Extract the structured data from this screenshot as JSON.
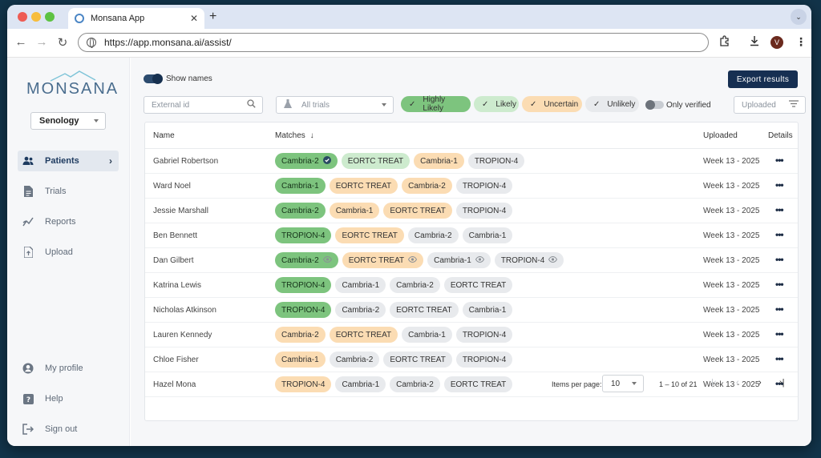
{
  "browser": {
    "tab_title": "Monsana App",
    "tab_close": "✕",
    "new_tab": "+",
    "tab_menu": "⌄",
    "url": "https://app.monsana.ai/assist/",
    "profile_initial": "V"
  },
  "sidebar": {
    "logo": "MONSANA",
    "dataset_selected": "Senology",
    "nav": [
      {
        "label": "Patients",
        "icon": "people-icon",
        "active": true
      },
      {
        "label": "Trials",
        "icon": "document-icon"
      },
      {
        "label": "Reports",
        "icon": "chart-icon"
      },
      {
        "label": "Upload",
        "icon": "upload-icon"
      }
    ],
    "bottom_nav": [
      {
        "label": "My profile",
        "icon": "account-icon"
      },
      {
        "label": "Help",
        "icon": "help-icon"
      },
      {
        "label": "Sign out",
        "icon": "signout-icon"
      }
    ]
  },
  "toolbar": {
    "show_names_label": "Show names",
    "export_label": "Export results",
    "external_id_placeholder": "External id",
    "trials_select": "All trials",
    "chips": {
      "highly_likely": "Highly Likely",
      "likely": "Likely",
      "uncertain": "Uncertain",
      "unlikely": "Unlikely"
    },
    "only_verified_label": "Only verified",
    "uploaded_sort": "Uploaded"
  },
  "colors": {
    "highly_likely": "#7dc47e",
    "likely": "#cdebce",
    "uncertain": "#fbdcb3",
    "unlikely": "#e8eaed",
    "primary": "#162f52"
  },
  "table": {
    "headers": {
      "name": "Name",
      "matches": "Matches",
      "uploaded": "Uploaded",
      "details": "Details"
    },
    "rows": [
      {
        "name": "Gabriel Robertson",
        "uploaded": "Week 13 - 2025",
        "matches": [
          {
            "label": "Cambria-2",
            "status": "hl",
            "verified": true
          },
          {
            "label": "EORTC TREAT",
            "status": "lk"
          },
          {
            "label": "Cambria-1",
            "status": "un"
          },
          {
            "label": "TROPION-4",
            "status": "ul"
          }
        ]
      },
      {
        "name": "Ward Noel",
        "uploaded": "Week 13 - 2025",
        "matches": [
          {
            "label": "Cambria-1",
            "status": "hl"
          },
          {
            "label": "EORTC TREAT",
            "status": "un"
          },
          {
            "label": "Cambria-2",
            "status": "un"
          },
          {
            "label": "TROPION-4",
            "status": "ul"
          }
        ]
      },
      {
        "name": "Jessie Marshall",
        "uploaded": "Week 13 - 2025",
        "matches": [
          {
            "label": "Cambria-2",
            "status": "hl"
          },
          {
            "label": "Cambria-1",
            "status": "un"
          },
          {
            "label": "EORTC TREAT",
            "status": "un"
          },
          {
            "label": "TROPION-4",
            "status": "ul"
          }
        ]
      },
      {
        "name": "Ben Bennett",
        "uploaded": "Week 13 - 2025",
        "matches": [
          {
            "label": "TROPION-4",
            "status": "hl"
          },
          {
            "label": "EORTC TREAT",
            "status": "un"
          },
          {
            "label": "Cambria-2",
            "status": "ul"
          },
          {
            "label": "Cambria-1",
            "status": "ul"
          }
        ]
      },
      {
        "name": "Dan Gilbert",
        "uploaded": "Week 13 - 2025",
        "matches": [
          {
            "label": "Cambria-2",
            "status": "hl",
            "viewed": true
          },
          {
            "label": "EORTC TREAT",
            "status": "un",
            "viewed": true
          },
          {
            "label": "Cambria-1",
            "status": "ul",
            "viewed": true
          },
          {
            "label": "TROPION-4",
            "status": "ul",
            "viewed": true
          }
        ]
      },
      {
        "name": "Katrina Lewis",
        "uploaded": "Week 13 - 2025",
        "matches": [
          {
            "label": "TROPION-4",
            "status": "hl"
          },
          {
            "label": "Cambria-1",
            "status": "ul"
          },
          {
            "label": "Cambria-2",
            "status": "ul"
          },
          {
            "label": "EORTC TREAT",
            "status": "ul"
          }
        ]
      },
      {
        "name": "Nicholas Atkinson",
        "uploaded": "Week 13 - 2025",
        "matches": [
          {
            "label": "TROPION-4",
            "status": "hl"
          },
          {
            "label": "Cambria-2",
            "status": "ul"
          },
          {
            "label": "EORTC TREAT",
            "status": "ul"
          },
          {
            "label": "Cambria-1",
            "status": "ul"
          }
        ]
      },
      {
        "name": "Lauren Kennedy",
        "uploaded": "Week 13 - 2025",
        "matches": [
          {
            "label": "Cambria-2",
            "status": "un"
          },
          {
            "label": "EORTC TREAT",
            "status": "un"
          },
          {
            "label": "Cambria-1",
            "status": "ul"
          },
          {
            "label": "TROPION-4",
            "status": "ul"
          }
        ]
      },
      {
        "name": "Chloe Fisher",
        "uploaded": "Week 13 - 2025",
        "matches": [
          {
            "label": "Cambria-1",
            "status": "un"
          },
          {
            "label": "Cambria-2",
            "status": "ul"
          },
          {
            "label": "EORTC TREAT",
            "status": "ul"
          },
          {
            "label": "TROPION-4",
            "status": "ul"
          }
        ]
      },
      {
        "name": "Hazel Mona",
        "uploaded": "Week 13 - 2025",
        "matches": [
          {
            "label": "TROPION-4",
            "status": "un"
          },
          {
            "label": "Cambria-1",
            "status": "ul"
          },
          {
            "label": "Cambria-2",
            "status": "ul"
          },
          {
            "label": "EORTC TREAT",
            "status": "ul"
          }
        ]
      }
    ]
  },
  "pagination": {
    "items_per_page_label": "Items per page:",
    "items_per_page": "10",
    "range": "1 – 10 of 21"
  }
}
